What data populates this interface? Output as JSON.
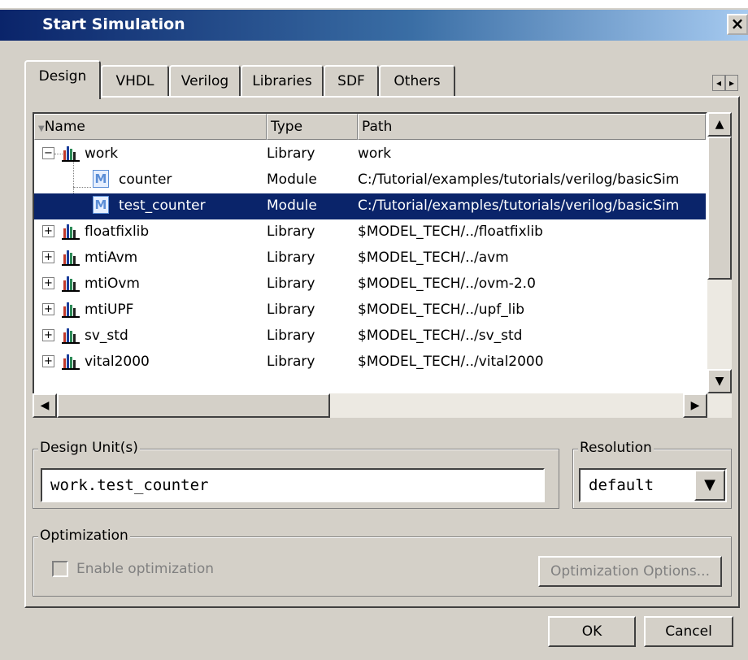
{
  "window": {
    "title": "Start Simulation"
  },
  "tabs": [
    {
      "label": "Design"
    },
    {
      "label": "VHDL"
    },
    {
      "label": "Verilog"
    },
    {
      "label": "Libraries"
    },
    {
      "label": "SDF"
    },
    {
      "label": "Others"
    }
  ],
  "tree": {
    "columns": {
      "name": "Name",
      "type": "Type",
      "path": "Path"
    },
    "rows": [
      {
        "name": "work",
        "type": "Library",
        "path": "work"
      },
      {
        "name": "counter",
        "type": "Module",
        "path": "C:/Tutorial/examples/tutorials/verilog/basicSim"
      },
      {
        "name": "test_counter",
        "type": "Module",
        "path": "C:/Tutorial/examples/tutorials/verilog/basicSim"
      },
      {
        "name": "floatfixlib",
        "type": "Library",
        "path": "$MODEL_TECH/../floatfixlib"
      },
      {
        "name": "mtiAvm",
        "type": "Library",
        "path": "$MODEL_TECH/../avm"
      },
      {
        "name": "mtiOvm",
        "type": "Library",
        "path": "$MODEL_TECH/../ovm-2.0"
      },
      {
        "name": "mtiUPF",
        "type": "Library",
        "path": "$MODEL_TECH/../upf_lib"
      },
      {
        "name": "sv_std",
        "type": "Library",
        "path": "$MODEL_TECH/../sv_std"
      },
      {
        "name": "vital2000",
        "type": "Library",
        "path": "$MODEL_TECH/../vital2000"
      }
    ]
  },
  "design_units": {
    "label": "Design Unit(s)",
    "value": "work.test_counter"
  },
  "resolution": {
    "label": "Resolution",
    "value": "default"
  },
  "optimization": {
    "label": "Optimization",
    "enable_label": "Enable optimization",
    "options_button": "Optimization Options..."
  },
  "buttons": {
    "ok": "OK",
    "cancel": "Cancel"
  },
  "icons": {
    "close": "close-icon",
    "library": "library-icon",
    "module": "module-icon"
  },
  "colors": {
    "selection": "#0a246a",
    "titlebar": "#0a246a"
  }
}
